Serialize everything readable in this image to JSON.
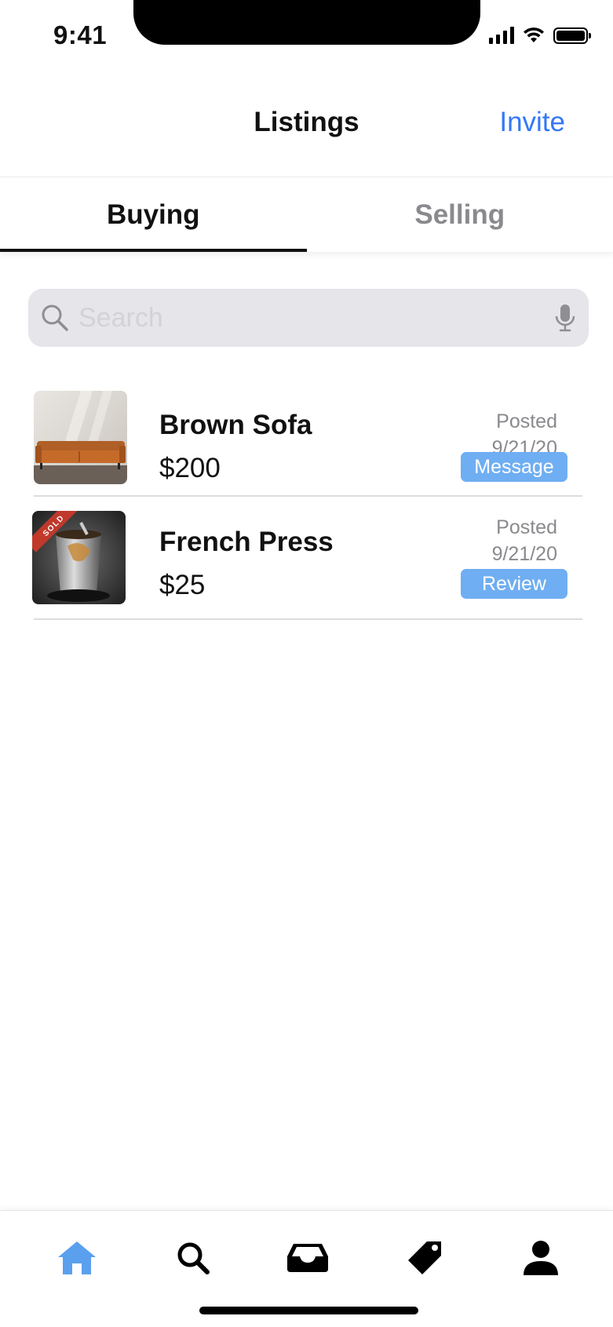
{
  "status_bar": {
    "time": "9:41"
  },
  "nav": {
    "title": "Listings",
    "invite_label": "Invite"
  },
  "tabs": [
    {
      "label": "Buying",
      "active": true
    },
    {
      "label": "Selling",
      "active": false
    }
  ],
  "search": {
    "placeholder": "Search",
    "value": ""
  },
  "listings": [
    {
      "title": "Brown Sofa",
      "price": "$200",
      "posted_label": "Posted",
      "posted_date": "9/21/20",
      "action_label": "Message",
      "sold": false
    },
    {
      "title": "French Press",
      "price": "$25",
      "posted_label": "Posted",
      "posted_date": "9/21/20",
      "action_label": "Review",
      "sold": true,
      "badge": "SOLD"
    }
  ],
  "tab_bar": {
    "items": [
      "home-icon",
      "search-icon",
      "inbox-icon",
      "tag-icon",
      "profile-icon"
    ],
    "active": "home-icon"
  },
  "colors": {
    "accent": "#3478f6",
    "button": "#6faef2",
    "active_tab_icon": "#5aa0ee",
    "sold_badge": "#c0392b"
  }
}
